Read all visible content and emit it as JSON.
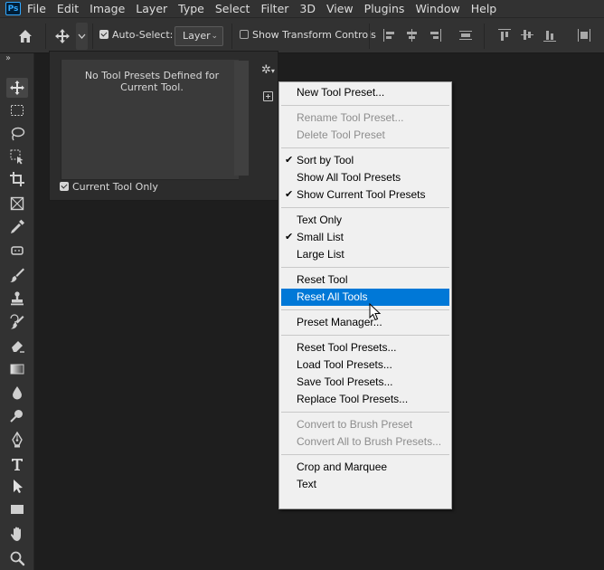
{
  "app": {
    "logo_text": "Ps",
    "menu": [
      "File",
      "Edit",
      "Image",
      "Layer",
      "Type",
      "Select",
      "Filter",
      "3D",
      "View",
      "Plugins",
      "Window",
      "Help"
    ]
  },
  "options_bar": {
    "auto_select_label": "Auto-Select:",
    "auto_select_checked": true,
    "auto_select_target": "Layer",
    "show_transform_label": "Show Transform Controls",
    "show_transform_checked": false
  },
  "toolbar": {
    "collapse_glyph": "››",
    "tools": [
      {
        "name": "move-tool",
        "icon": "move-icon",
        "active": true
      },
      {
        "name": "rectangular-marquee-tool",
        "icon": "marquee-icon"
      },
      {
        "name": "lasso-tool",
        "icon": "lasso-icon"
      },
      {
        "name": "object-selection-tool",
        "icon": "object-selection-icon"
      },
      {
        "name": "crop-tool",
        "icon": "crop-icon"
      },
      {
        "name": "frame-tool",
        "icon": "frame-icon"
      },
      {
        "name": "eyedropper-tool",
        "icon": "eyedropper-icon"
      },
      {
        "name": "spot-healing-brush-tool",
        "icon": "healing-icon"
      },
      {
        "name": "brush-tool",
        "icon": "brush-icon"
      },
      {
        "name": "clone-stamp-tool",
        "icon": "stamp-icon"
      },
      {
        "name": "history-brush-tool",
        "icon": "history-brush-icon"
      },
      {
        "name": "eraser-tool",
        "icon": "eraser-icon"
      },
      {
        "name": "gradient-tool",
        "icon": "gradient-icon"
      },
      {
        "name": "blur-tool",
        "icon": "blur-icon"
      },
      {
        "name": "dodge-tool",
        "icon": "dodge-icon"
      },
      {
        "name": "pen-tool",
        "icon": "pen-icon"
      },
      {
        "name": "type-tool",
        "icon": "type-icon"
      },
      {
        "name": "path-selection-tool",
        "icon": "path-selection-icon"
      },
      {
        "name": "rectangle-tool",
        "icon": "rectangle-icon"
      },
      {
        "name": "hand-tool",
        "icon": "hand-icon"
      },
      {
        "name": "zoom-tool",
        "icon": "zoom-icon"
      }
    ]
  },
  "preset_panel": {
    "empty_message": "No Tool Presets Defined for Current Tool.",
    "current_tool_only_label": "Current Tool Only",
    "current_tool_only_checked": true,
    "gear_glyph": "✲",
    "gear_caret": "▾"
  },
  "context_menu": {
    "groups": [
      [
        {
          "label": "New Tool Preset..."
        }
      ],
      [
        {
          "label": "Rename Tool Preset...",
          "disabled": true
        },
        {
          "label": "Delete Tool Preset",
          "disabled": true
        }
      ],
      [
        {
          "label": "Sort by Tool",
          "checked": true
        },
        {
          "label": "Show All Tool Presets"
        },
        {
          "label": "Show Current Tool Presets",
          "checked": true
        }
      ],
      [
        {
          "label": "Text Only"
        },
        {
          "label": "Small List",
          "checked": true
        },
        {
          "label": "Large List"
        }
      ],
      [
        {
          "label": "Reset Tool"
        },
        {
          "label": "Reset All Tools",
          "highlighted": true
        }
      ],
      [
        {
          "label": "Preset Manager..."
        }
      ],
      [
        {
          "label": "Reset Tool Presets..."
        },
        {
          "label": "Load Tool Presets..."
        },
        {
          "label": "Save Tool Presets..."
        },
        {
          "label": "Replace Tool Presets..."
        }
      ],
      [
        {
          "label": "Convert to Brush Preset",
          "disabled": true
        },
        {
          "label": "Convert All to Brush Presets...",
          "disabled": true
        }
      ],
      [
        {
          "label": "Crop and Marquee"
        },
        {
          "label": "Text"
        }
      ]
    ]
  },
  "colors": {
    "chrome": "#323232",
    "canvas": "#1e1e1e",
    "menu_bg": "#f0f0f0",
    "menu_highlight": "#0078d7",
    "menu_disabled": "#8d8d8d"
  }
}
